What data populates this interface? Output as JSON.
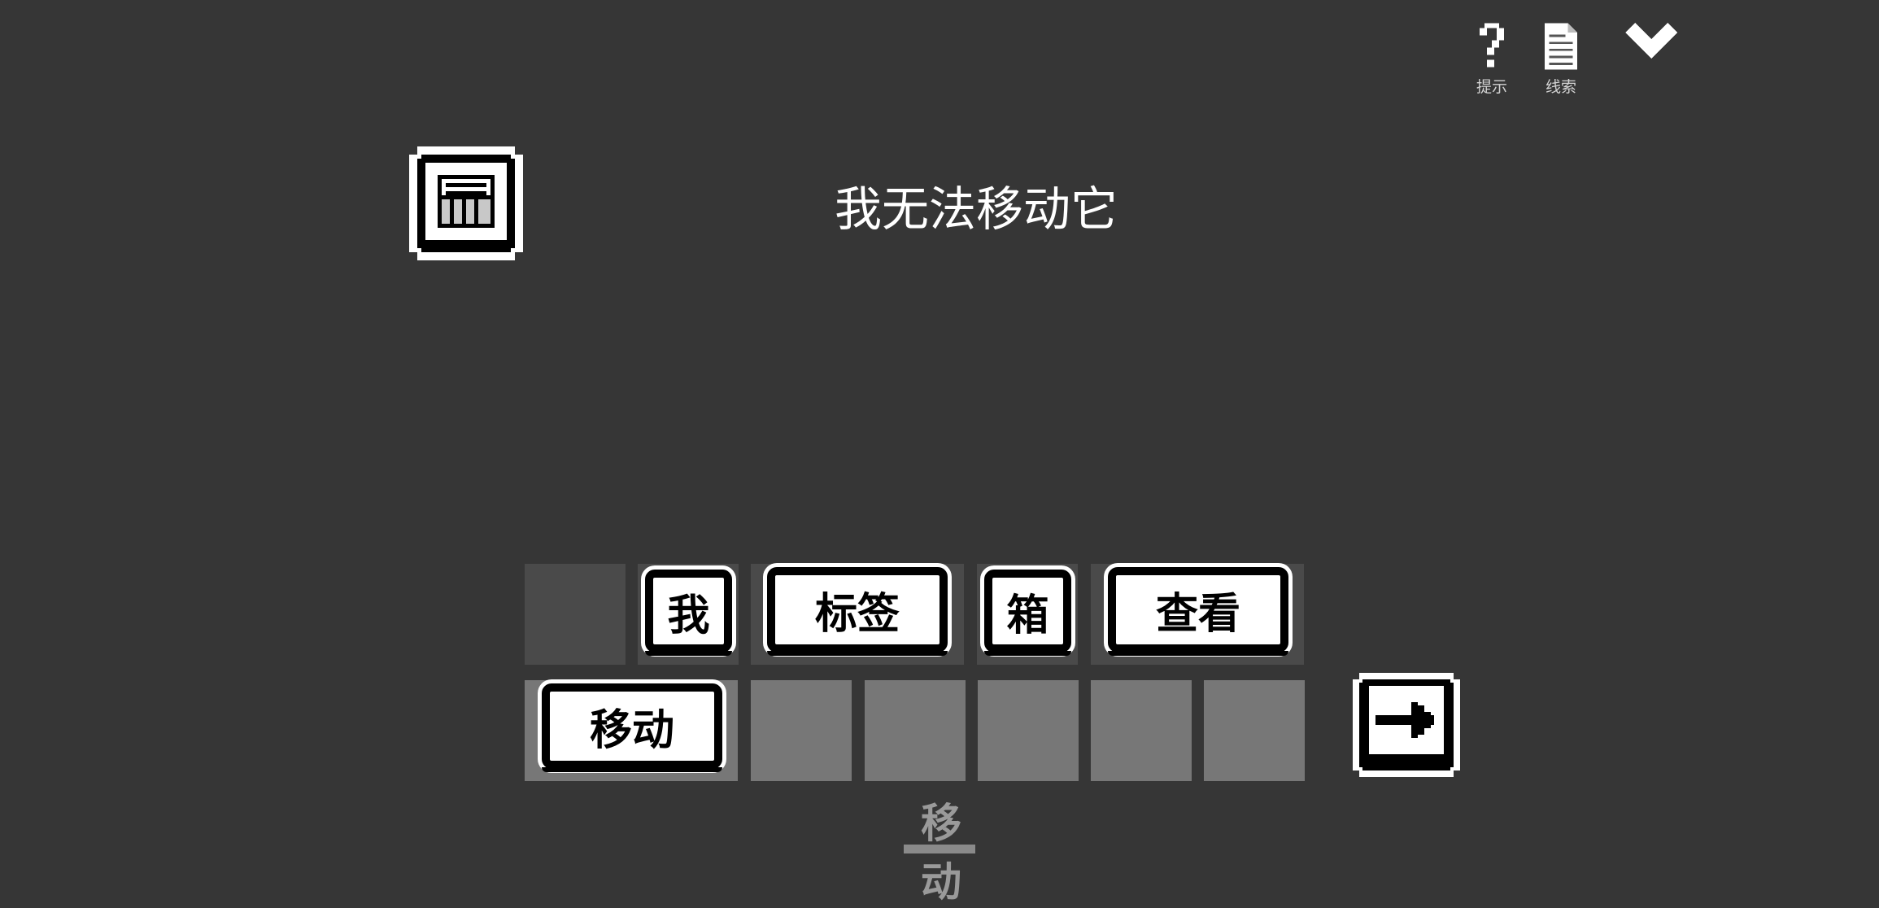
{
  "toolbar": {
    "hint_label": "提示",
    "clue_label": "线索"
  },
  "item": {
    "icon": "box-label-icon"
  },
  "message": "我无法移动它",
  "sentence_row": [
    {
      "label": ""
    },
    {
      "label": "我"
    },
    {
      "label": "标签"
    },
    {
      "label": "箱"
    },
    {
      "label": "查看"
    }
  ],
  "verb_row": [
    {
      "label": "移动"
    },
    {
      "label": ""
    },
    {
      "label": ""
    },
    {
      "label": ""
    },
    {
      "label": ""
    },
    {
      "label": ""
    }
  ],
  "submit": {
    "icon": "arrow-right-icon"
  },
  "tab": {
    "label": "移动"
  },
  "colors": {
    "background": "#363636",
    "tile": "#ffffff",
    "slot_dark": "#4a4a4a",
    "slot_light": "#777777"
  }
}
